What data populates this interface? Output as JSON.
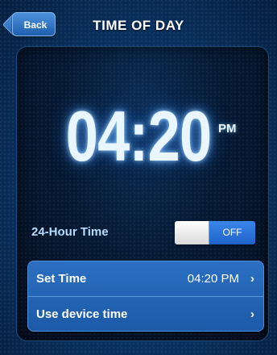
{
  "header": {
    "back_label": "Back",
    "title": "TIME OF DAY"
  },
  "clock": {
    "time": "04:20",
    "ampm": "PM"
  },
  "hour_mode": {
    "label": "24-Hour Time",
    "toggle_state": "OFF"
  },
  "settings": [
    {
      "label": "Set Time",
      "value": "04:20 PM",
      "chevron": "›"
    },
    {
      "label": "Use device time",
      "chevron": "›"
    }
  ],
  "colors": {
    "background": "#0a3566",
    "panel": "#061a34",
    "accent": "#2c6fc2",
    "toggle_on": "#3a86ea",
    "label_text": "#b7dcff"
  },
  "icons": {
    "back": "back-arrow-icon",
    "chevron": "chevron-right-icon"
  }
}
